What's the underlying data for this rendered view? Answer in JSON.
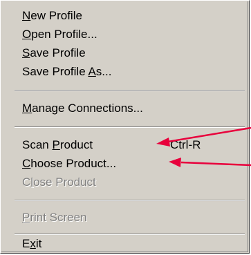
{
  "menu": {
    "items": [
      {
        "pre": "",
        "key": "N",
        "post": "ew Profile",
        "enabled": true
      },
      {
        "pre": "",
        "key": "O",
        "post": "pen Profile...",
        "enabled": true
      },
      {
        "pre": "",
        "key": "S",
        "post": "ave Profile",
        "enabled": true
      },
      {
        "pre": "Save Profile ",
        "key": "A",
        "post": "s...",
        "enabled": true
      },
      {
        "pre": "",
        "key": "M",
        "post": "anage Connections...",
        "enabled": true
      },
      {
        "pre": "Scan ",
        "key": "P",
        "post": "roduct",
        "enabled": true,
        "shortcut": "Ctrl-R"
      },
      {
        "pre": "",
        "key": "C",
        "post": "hoose Product...",
        "enabled": true
      },
      {
        "pre": "C",
        "key": "l",
        "post": "ose Product",
        "enabled": false
      },
      {
        "pre": "",
        "key": "P",
        "post": "rint Screen",
        "enabled": false
      },
      {
        "pre": "E",
        "key": "x",
        "post": "it",
        "enabled": true
      }
    ]
  },
  "colors": {
    "menu_bg": "#d4d0c8",
    "arrow": "#e8003c",
    "disabled_text": "#808080"
  }
}
